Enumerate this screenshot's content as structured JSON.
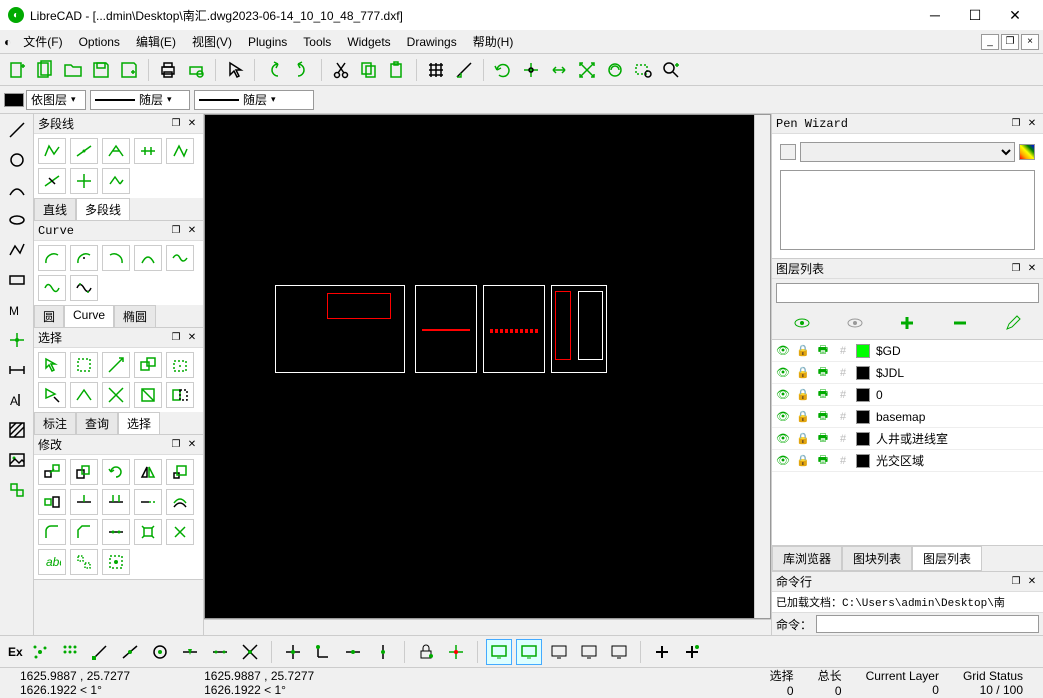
{
  "title": "LibreCAD - [...dmin\\Desktop\\南汇.dwg2023-06-14_10_10_48_777.dxf]",
  "menu": {
    "file": "文件(F)",
    "options": "Options",
    "edit": "编辑(E)",
    "view": "视图(V)",
    "plugins": "Plugins",
    "tools": "Tools",
    "widgets": "Widgets",
    "drawings": "Drawings",
    "help": "帮助(H)"
  },
  "layerCombo": "依图层",
  "lineCombo1": "随层",
  "lineCombo2": "随层",
  "panels": {
    "polyline": {
      "title": "多段线",
      "tabs": [
        "直线",
        "多段线"
      ]
    },
    "curve": {
      "title": "Curve",
      "tabs": [
        "圆",
        "Curve",
        "椭圆"
      ]
    },
    "select": {
      "title": "选择",
      "tabs": [
        "标注",
        "查询",
        "选择"
      ]
    },
    "modify": {
      "title": "修改"
    }
  },
  "penWizard": {
    "title": "Pen Wizard"
  },
  "layerList": {
    "title": "图层列表",
    "layers": [
      {
        "name": "$GD",
        "color": "#00ff00"
      },
      {
        "name": "$JDL",
        "color": "#000000"
      },
      {
        "name": "0",
        "color": "#000000"
      },
      {
        "name": "basemap",
        "color": "#000000"
      },
      {
        "name": "人井或进线室",
        "color": "#000000"
      },
      {
        "name": "光交区域",
        "color": "#000000"
      }
    ],
    "tabs": [
      "库浏览器",
      "图块列表",
      "图层列表"
    ]
  },
  "cmd": {
    "title": "命令行",
    "loaded": "已加载文档：C:\\Users\\admin\\Desktop\\南",
    "prompt": "命令："
  },
  "status": {
    "ex": "Ex",
    "coord1a": "1625.9887 , 25.7277",
    "coord1b": "1626.1922 < 1°",
    "coord2a": "1625.9887 , 25.7277",
    "coord2b": "1626.1922 < 1°",
    "sel_label": "选择",
    "sel_val": "0",
    "len_label": "总长",
    "len_val": "0",
    "layer_label": "Current Layer",
    "layer_val": "0",
    "grid_label": "Grid Status",
    "grid_val": "10 / 100"
  }
}
